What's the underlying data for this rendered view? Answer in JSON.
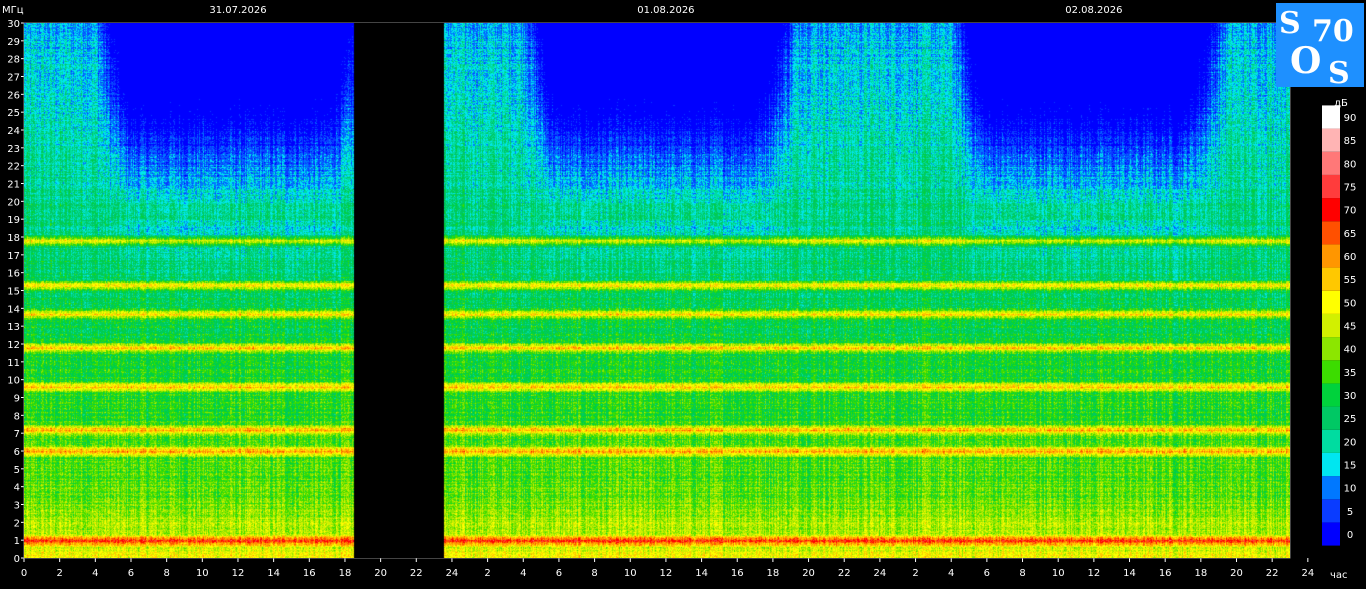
{
  "chart_data": {
    "type": "heatmap",
    "ylabel": "МГц",
    "xlabel": "час",
    "ylim": [
      0,
      30
    ],
    "yticks": [
      0,
      1,
      2,
      3,
      4,
      5,
      6,
      7,
      8,
      9,
      10,
      11,
      12,
      13,
      14,
      15,
      16,
      17,
      18,
      19,
      20,
      21,
      22,
      23,
      24,
      25,
      26,
      27,
      28,
      29,
      30
    ],
    "x_hours_total": 71,
    "xticks": [
      {
        "h": 0,
        "label": "0"
      },
      {
        "h": 2,
        "label": "2"
      },
      {
        "h": 4,
        "label": "4"
      },
      {
        "h": 6,
        "label": "6"
      },
      {
        "h": 8,
        "label": "8"
      },
      {
        "h": 10,
        "label": "10"
      },
      {
        "h": 12,
        "label": "12"
      },
      {
        "h": 14,
        "label": "14"
      },
      {
        "h": 16,
        "label": "16"
      },
      {
        "h": 18,
        "label": "18"
      },
      {
        "h": 20,
        "label": "20"
      },
      {
        "h": 22,
        "label": "22"
      },
      {
        "h": 24,
        "label": "24"
      },
      {
        "h": 26,
        "label": "2"
      },
      {
        "h": 28,
        "label": "4"
      },
      {
        "h": 30,
        "label": "6"
      },
      {
        "h": 32,
        "label": "8"
      },
      {
        "h": 34,
        "label": "10"
      },
      {
        "h": 36,
        "label": "12"
      },
      {
        "h": 38,
        "label": "14"
      },
      {
        "h": 40,
        "label": "16"
      },
      {
        "h": 42,
        "label": "18"
      },
      {
        "h": 44,
        "label": "20"
      },
      {
        "h": 46,
        "label": "22"
      },
      {
        "h": 48,
        "label": "24"
      },
      {
        "h": 50,
        "label": "2"
      },
      {
        "h": 52,
        "label": "4"
      },
      {
        "h": 54,
        "label": "6"
      },
      {
        "h": 56,
        "label": "8"
      },
      {
        "h": 58,
        "label": "10"
      },
      {
        "h": 60,
        "label": "12"
      },
      {
        "h": 62,
        "label": "14"
      },
      {
        "h": 64,
        "label": "16"
      },
      {
        "h": 66,
        "label": "18"
      },
      {
        "h": 68,
        "label": "20"
      },
      {
        "h": 70,
        "label": "22"
      },
      {
        "h": 72,
        "label": "24"
      }
    ],
    "dates": [
      {
        "h": 12,
        "label": "31.07.2026"
      },
      {
        "h": 36,
        "label": "01.08.2026"
      },
      {
        "h": 60,
        "label": "02.08.2026"
      }
    ],
    "no_data_hours": [
      [
        18.5,
        23.5
      ]
    ],
    "legend": {
      "unit": "дБ",
      "placement": "right",
      "levels": [
        0,
        5,
        10,
        15,
        20,
        25,
        30,
        35,
        40,
        45,
        50,
        55,
        60,
        65,
        70,
        75,
        80,
        85,
        90
      ],
      "colors": [
        "#0000ff",
        "#0a3cff",
        "#0078ff",
        "#00e6f0",
        "#00dca0",
        "#00c864",
        "#00d23c",
        "#3cdc00",
        "#8ce600",
        "#d2f000",
        "#ffff00",
        "#ffc800",
        "#ff9600",
        "#ff5000",
        "#ff0000",
        "#ff3c3c",
        "#ff7878",
        "#ffb4b4",
        "#ffffff"
      ]
    },
    "bands_mhz": [
      1.0,
      6.0,
      7.2,
      9.6,
      11.8,
      13.7,
      15.3,
      17.8
    ],
    "grid": true
  },
  "logo_text": [
    "S",
    "70",
    "O",
    "S"
  ]
}
